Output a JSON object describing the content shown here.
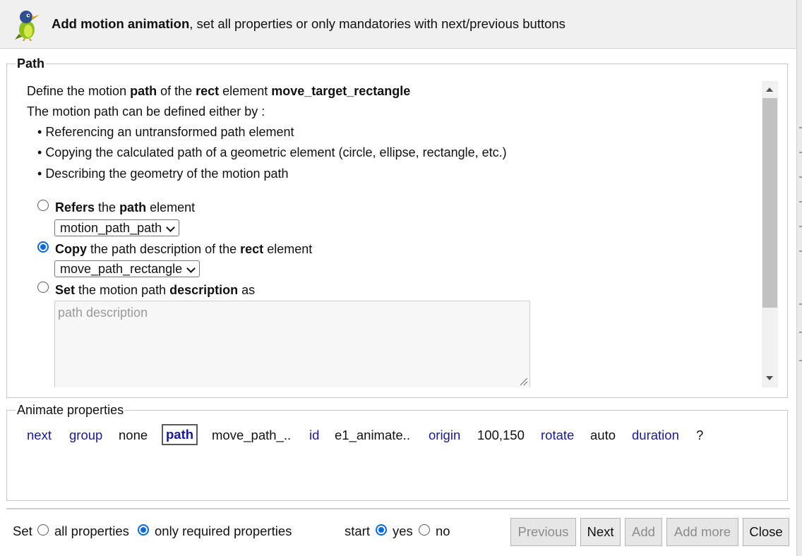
{
  "header": {
    "title_bold": "Add motion animation",
    "title_rest": ", set all properties or only mandatories with next/previous buttons"
  },
  "path_section": {
    "legend": "Path",
    "intro": {
      "t1": "Define the motion ",
      "b1": "path",
      "t2": " of the ",
      "b2": "rect",
      "t3": " element ",
      "b3": "move_target_rectangle"
    },
    "either_by": "The motion path can be defined either by :",
    "bullets": [
      "Referencing an untransformed path element",
      "Copying the calculated path of a geometric element (circle, ellipse, rectangle, etc.)",
      "Describing the geometry of the motion path"
    ],
    "option_refers": {
      "b1": "Refers",
      "t1": " the ",
      "b2": "path",
      "t2": " element",
      "checked": false
    },
    "refers_select_value": "motion_path_path",
    "option_copy": {
      "b1": "Copy",
      "t1": " the path description of the ",
      "b2": "rect",
      "t2": " element",
      "checked": true
    },
    "copy_select_value": "move_path_rectangle",
    "option_set": {
      "b1": "Set",
      "t1": " the motion path ",
      "b2": "description",
      "t2": " as",
      "checked": false
    },
    "description_placeholder": "path description"
  },
  "animate_section": {
    "legend": "Animate properties",
    "items": [
      {
        "text": "next",
        "type": "link"
      },
      {
        "text": "group",
        "type": "link"
      },
      {
        "text": "none",
        "type": "value"
      },
      {
        "text": "path",
        "type": "active"
      },
      {
        "text": "move_path_..",
        "type": "value"
      },
      {
        "text": "id",
        "type": "link"
      },
      {
        "text": "e1_animate..",
        "type": "value"
      },
      {
        "text": "origin",
        "type": "link"
      },
      {
        "text": "100,150",
        "type": "value"
      },
      {
        "text": "rotate",
        "type": "link"
      },
      {
        "text": "auto",
        "type": "value"
      },
      {
        "text": "duration",
        "type": "link"
      },
      {
        "text": "?",
        "type": "value"
      }
    ]
  },
  "footer": {
    "set_label": "Set",
    "all_properties": "all properties",
    "only_required": "only required properties",
    "all_checked": false,
    "required_checked": true,
    "start_label": "start",
    "yes": "yes",
    "no": "no",
    "yes_checked": true,
    "no_checked": false,
    "buttons": {
      "previous": "Previous",
      "next": "Next",
      "add": "Add",
      "add_more": "Add more",
      "close": "Close"
    }
  },
  "colors": {
    "accent": "#0a6ad7",
    "link": "#1a1a8f",
    "header_bg": "#f0f0f0"
  }
}
